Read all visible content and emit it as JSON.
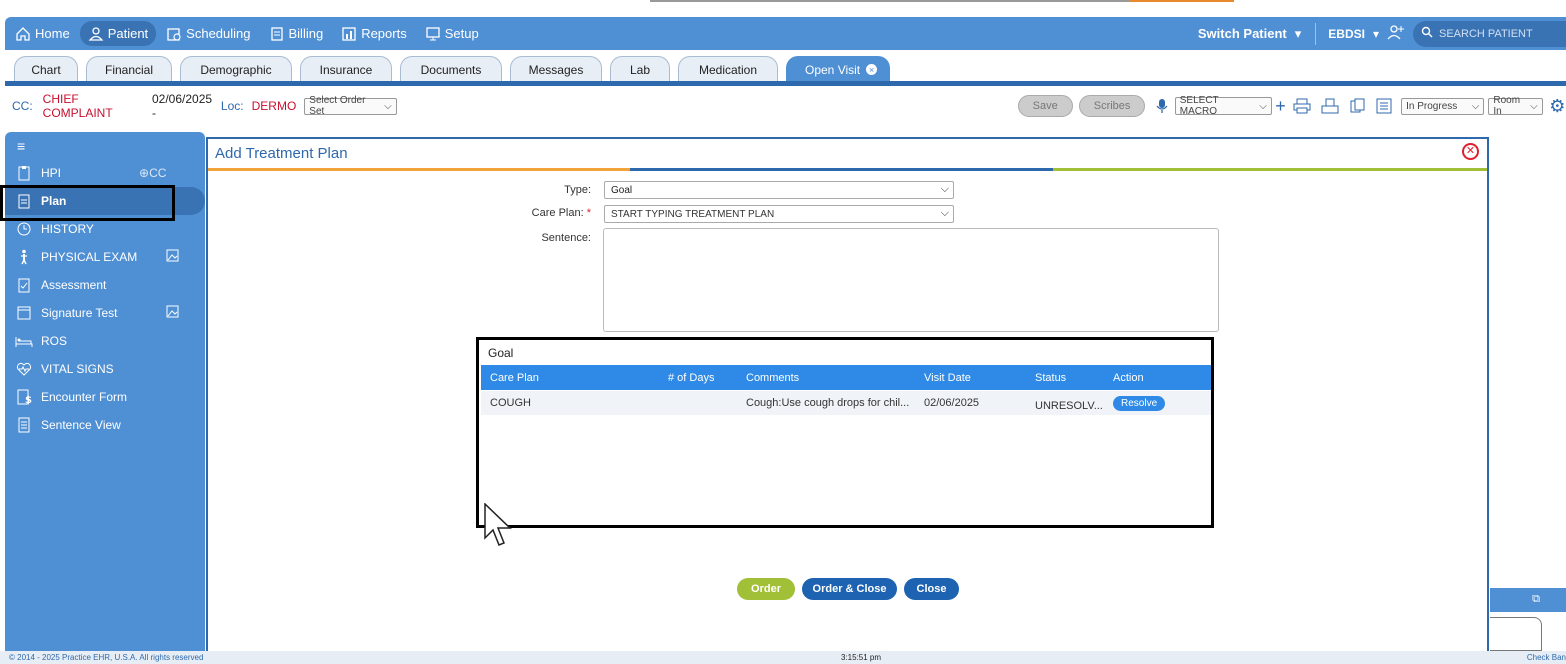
{
  "navbar": {
    "items": [
      {
        "label": "Home",
        "icon": "home-icon"
      },
      {
        "label": "Patient",
        "icon": "person-icon"
      },
      {
        "label": "Scheduling",
        "icon": "calendar-icon"
      },
      {
        "label": "Billing",
        "icon": "document-icon"
      },
      {
        "label": "Reports",
        "icon": "chart-icon"
      },
      {
        "label": "Setup",
        "icon": "monitor-icon"
      }
    ],
    "active": "Patient",
    "switch_patient": "Switch Patient",
    "user": "EBDSI",
    "search_placeholder": "SEARCH PATIENT"
  },
  "tabs": [
    "Chart",
    "Financial",
    "Demographic",
    "Insurance",
    "Documents",
    "Messages",
    "Lab",
    "Medication",
    "Open Visit"
  ],
  "ccbar": {
    "cc_label": "CC:",
    "chief_complaint": "CHIEF COMPLAINT",
    "date": "02/06/2025 -",
    "loc_label": "Loc:",
    "loc": "DERMO",
    "order_set": "Select Order Set",
    "save": "Save",
    "scribes": "Scribes",
    "macro": "SELECT MACRO",
    "status": "In Progress",
    "room": "Room In"
  },
  "sidebar": {
    "items": [
      {
        "label": "HPI",
        "extra": "CC"
      },
      {
        "label": "Plan"
      },
      {
        "label": "HISTORY"
      },
      {
        "label": "PHYSICAL EXAM"
      },
      {
        "label": "Assessment"
      },
      {
        "label": "Signature Test"
      },
      {
        "label": "ROS"
      },
      {
        "label": "VITAL SIGNS"
      },
      {
        "label": "Encounter Form"
      },
      {
        "label": "Sentence View"
      }
    ],
    "selected": "Plan"
  },
  "modal": {
    "title": "Add Treatment Plan",
    "type_label": "Type:",
    "type_value": "Goal",
    "careplan_label": "Care Plan:",
    "careplan_required": "*",
    "careplan_placeholder": "START TYPING TREATMENT PLAN",
    "sentence_label": "Sentence:",
    "grid": {
      "title": "Goal",
      "columns": [
        "Care Plan",
        "# of Days",
        "Comments",
        "Visit Date",
        "Status",
        "Action"
      ],
      "rows": [
        {
          "care_plan": "COUGH",
          "days": "",
          "comments": "Cough:Use cough drops for chil...",
          "visit_date": "02/06/2025",
          "status": "UNRESOLV...",
          "action": "Resolve"
        }
      ]
    },
    "buttons": {
      "order": "Order",
      "order_close": "Order & Close",
      "close": "Close"
    }
  },
  "footer": {
    "copyright": "© 2014 - 2025 Practice EHR, U.S.A. All rights reserved",
    "time": "3:15:51 pm",
    "right": "Check Ban"
  },
  "colors": {
    "primary": "#4f8fd4",
    "dark": "#2f69ad",
    "red": "#c8102e",
    "grid_head": "#2e8ae6",
    "order": "#a2c037"
  }
}
